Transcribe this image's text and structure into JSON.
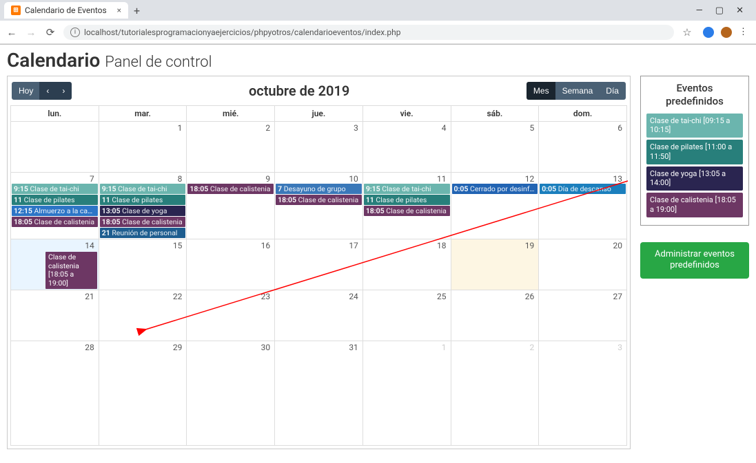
{
  "browser": {
    "tab_title": "Calendario de Eventos",
    "url": "localhost/tutorialesprogramacionyaejercicios/phpyotros/calendarioeventos/index.php"
  },
  "page": {
    "title_main": "Calendario",
    "title_sub": "Panel de control"
  },
  "toolbar": {
    "today": "Hoy",
    "title": "octubre de 2019",
    "view_month": "Mes",
    "view_week": "Semana",
    "view_day": "Día"
  },
  "day_headers": [
    "lun.",
    "mar.",
    "mié.",
    "jue.",
    "vie.",
    "sáb.",
    "dom."
  ],
  "weeks": [
    {
      "cls": "",
      "days": [
        {
          "n": "",
          "cls": "other-month"
        },
        {
          "n": "1"
        },
        {
          "n": "2"
        },
        {
          "n": "3"
        },
        {
          "n": "4"
        },
        {
          "n": "5"
        },
        {
          "n": "6"
        }
      ]
    },
    {
      "cls": "tall",
      "days": [
        {
          "n": "7",
          "events": [
            {
              "t": "9:15",
              "title": "Clase de tai-chi",
              "c": "c-taichi"
            },
            {
              "t": "11",
              "title": "Clase de pilates",
              "c": "c-pilates"
            },
            {
              "t": "12:15",
              "title": "Almuerzo a la canasta",
              "c": "c-canasta"
            },
            {
              "t": "18:05",
              "title": "Clase de calistenia",
              "c": "c-calistenia"
            }
          ]
        },
        {
          "n": "8",
          "events": [
            {
              "t": "9:15",
              "title": "Clase de tai-chi",
              "c": "c-taichi"
            },
            {
              "t": "11",
              "title": "Clase de pilates",
              "c": "c-pilates"
            },
            {
              "t": "13:05",
              "title": "Clase de yoga",
              "c": "c-yoga"
            },
            {
              "t": "18:05",
              "title": "Clase de calistenia",
              "c": "c-calistenia"
            },
            {
              "t": "21",
              "title": "Reunión de personal",
              "c": "c-personal"
            }
          ]
        },
        {
          "n": "9",
          "events": [
            {
              "t": "18:05",
              "title": "Clase de calistenia",
              "c": "c-calistenia"
            }
          ]
        },
        {
          "n": "10",
          "events": [
            {
              "t": "7",
              "title": "Desayuno de grupo",
              "c": "c-desayuno"
            },
            {
              "t": "18:05",
              "title": "Clase de calistenia",
              "c": "c-calistenia"
            }
          ]
        },
        {
          "n": "11",
          "events": [
            {
              "t": "9:15",
              "title": "Clase de tai-chi",
              "c": "c-taichi"
            },
            {
              "t": "11",
              "title": "Clase de pilates",
              "c": "c-pilates"
            },
            {
              "t": "18:05",
              "title": "Clase de calistenia",
              "c": "c-calistenia"
            }
          ]
        },
        {
          "n": "12",
          "events": [
            {
              "t": "0:05",
              "title": "Cerrado por desinfecció",
              "c": "c-cerrado"
            }
          ]
        },
        {
          "n": "13",
          "events": [
            {
              "t": "0:05",
              "title": "Día de descanso",
              "c": "c-descanso"
            }
          ]
        }
      ]
    },
    {
      "cls": "",
      "days": [
        {
          "n": "14",
          "cls": "highlight-blue",
          "drag": {
            "label": "Clase de calistenia [18:05 a 19:00]",
            "c": "c-calistenia"
          }
        },
        {
          "n": "15"
        },
        {
          "n": "16"
        },
        {
          "n": "17"
        },
        {
          "n": "18"
        },
        {
          "n": "19",
          "cls": "highlight-yellow"
        },
        {
          "n": "20"
        }
      ]
    },
    {
      "cls": "",
      "days": [
        {
          "n": "21"
        },
        {
          "n": "22"
        },
        {
          "n": "23"
        },
        {
          "n": "24"
        },
        {
          "n": "25"
        },
        {
          "n": "26"
        },
        {
          "n": "27"
        }
      ]
    },
    {
      "cls": "big",
      "days": [
        {
          "n": "28"
        },
        {
          "n": "29"
        },
        {
          "n": "30"
        },
        {
          "n": "31"
        },
        {
          "n": "1",
          "cls": "other-month"
        },
        {
          "n": "2",
          "cls": "other-month"
        },
        {
          "n": "3",
          "cls": "other-month"
        }
      ]
    }
  ],
  "sidebar": {
    "title": "Eventos predefinidos",
    "items": [
      {
        "label": "Clase de tai-chi [09:15 a 10:15]",
        "c": "c-taichi"
      },
      {
        "label": "Clase de pilates [11:00 a 11:50]",
        "c": "c-pilates"
      },
      {
        "label": "Clase de yoga [13:05 a 14:00]",
        "c": "c-yoga"
      },
      {
        "label": "Clase de calistenia [18:05 a 19:00]",
        "c": "c-calistenia"
      }
    ],
    "admin_button": "Administrar eventos predefinidos"
  }
}
